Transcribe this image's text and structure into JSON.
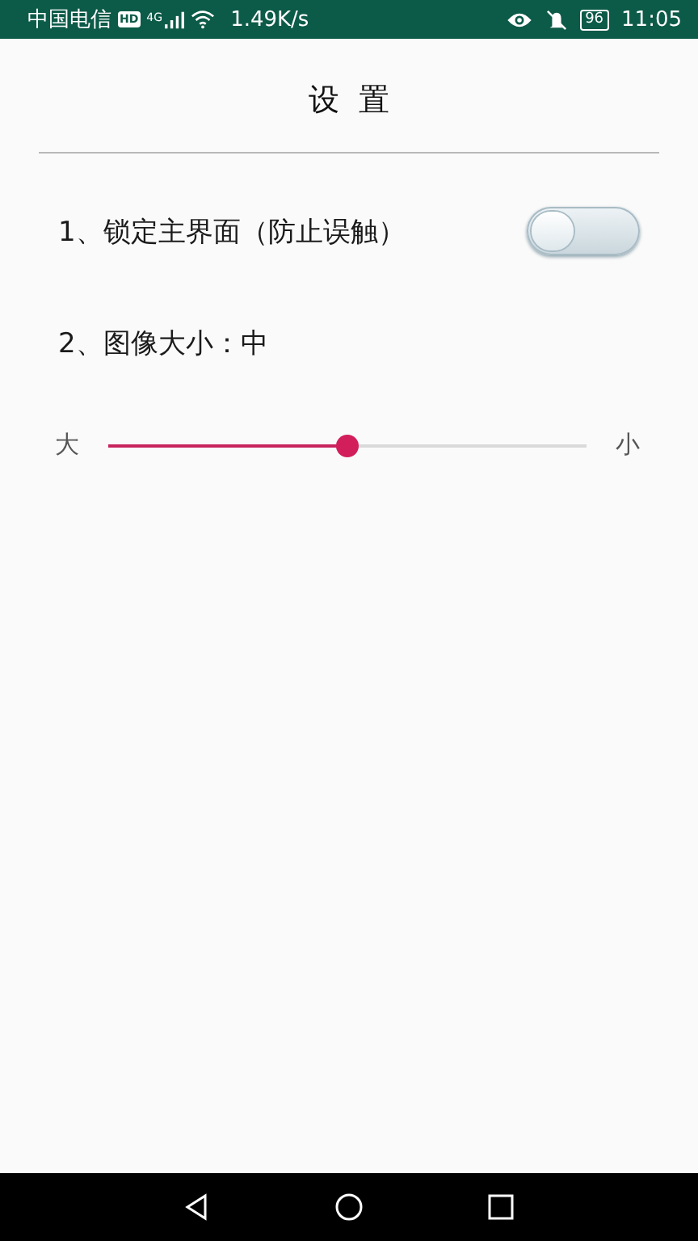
{
  "status_bar": {
    "carrier": "中国电信",
    "hd_badge": "HD",
    "network": "4G",
    "speed": "1.49K/s",
    "battery": "96",
    "time": "11:05"
  },
  "title": "设  置",
  "settings": [
    {
      "kind": "toggle",
      "label": "1、锁定主界面（防止误触）",
      "checked": false
    },
    {
      "kind": "slider",
      "label": "2、图像大小：中",
      "min_label": "大",
      "max_label": "小",
      "level": 0.5
    }
  ]
}
